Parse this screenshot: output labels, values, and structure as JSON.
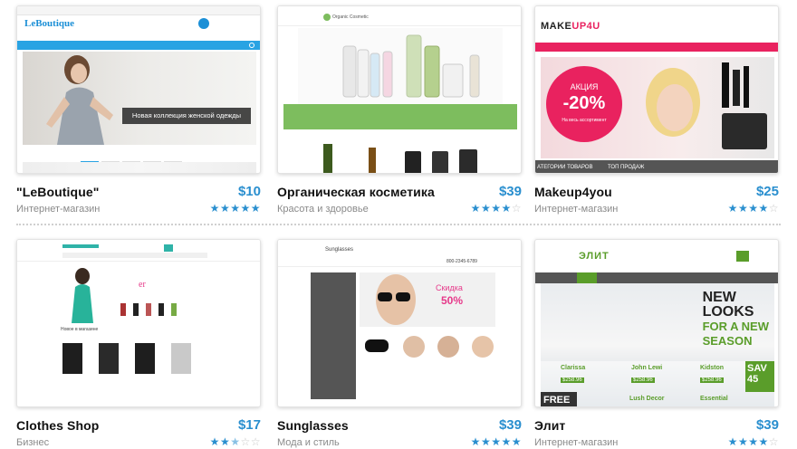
{
  "colors": {
    "accent": "#2a8fcf",
    "muted": "#8a8a8a"
  },
  "star_icon": "star-icon",
  "cards": [
    {
      "title": "\"LeBoutique\"",
      "price": "$10",
      "category": "Интернет-магазин",
      "rating": 5,
      "thumb": {
        "logo": "LeBoutique",
        "banner": "Новая коллекция женской одежды"
      }
    },
    {
      "title": "Органическая косметика",
      "price": "$39",
      "category": "Красота и здоровье",
      "rating": 4,
      "thumb": {
        "logo": "Organic Cosmetic"
      }
    },
    {
      "title": "Makeup4you",
      "price": "$25",
      "category": "Интернет-магазин",
      "rating": 4,
      "thumb": {
        "logo_a": "MAKE",
        "logo_b": "UP4U",
        "sale_label": "АКЦИЯ",
        "sale_value": "-20%",
        "sale_sub": "На весь ассортимент",
        "cat_label": "АТЕГОРИИ ТОВАРОВ",
        "top_label": "ТОП ПРОДАЖ"
      }
    },
    {
      "title": "Clothes Shop",
      "price": "$17",
      "category": "Бизнес",
      "rating": 2.5,
      "thumb": {
        "section": "Новое в магазине"
      }
    },
    {
      "title": "Sunglasses",
      "price": "$39",
      "category": "Мода и стиль",
      "rating": 5,
      "thumb": {
        "logo": "Sunglasses",
        "phone": "800-2345-6789",
        "sale_label": "Скидка",
        "sale_value": "50%"
      }
    },
    {
      "title": "Элит",
      "price": "$39",
      "category": "Интернет-магазин",
      "rating": 4,
      "thumb": {
        "logo": "ЭЛИТ",
        "line1": "NEW",
        "line2": "LOOKS",
        "line3": "FOR A NEW",
        "line4": "SEASON",
        "label1": "Clarissa",
        "label2": "John Lewi",
        "label3": "Kidston",
        "label4": "FREE",
        "label5": "Lush Decor",
        "label6": "Essential",
        "price1": "$258.96",
        "price2": "$258.96",
        "price3": "$258.96",
        "sale": "SAV",
        "sale_pct": "45"
      }
    }
  ]
}
